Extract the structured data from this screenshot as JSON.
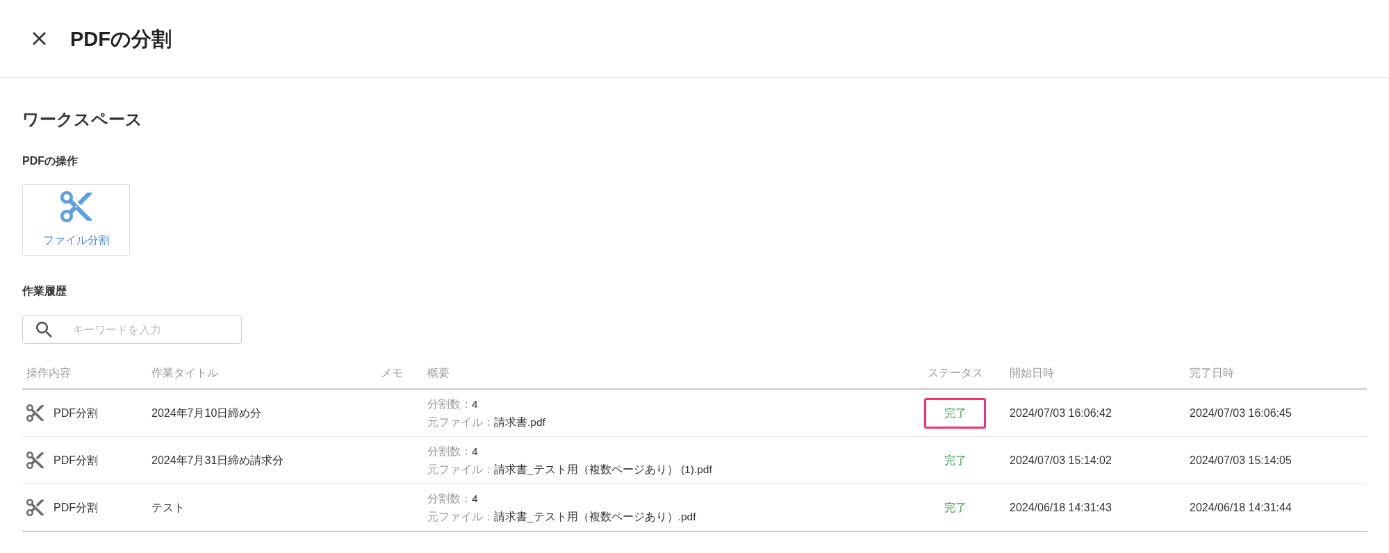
{
  "header": {
    "title": "PDFの分割"
  },
  "workspace": {
    "title": "ワークスペース"
  },
  "operations": {
    "heading": "PDFの操作",
    "items": [
      {
        "label": "ファイル分割"
      }
    ]
  },
  "history": {
    "heading": "作業履歴",
    "search": {
      "placeholder": "キーワードを入力"
    },
    "columns": [
      "操作内容",
      "作業タイトル",
      "メモ",
      "概要",
      "ステータス",
      "開始日時",
      "完了日時"
    ],
    "rows": [
      {
        "operation": "PDF分割",
        "title": "2024年7月10日締め分",
        "summary": [
          {
            "label": "分割数：",
            "value": "4"
          },
          {
            "label": "元ファイル：",
            "value": "請求書.pdf"
          }
        ],
        "status": "完了",
        "highlighted": true,
        "started": "2024/07/03 16:06:42",
        "finished": "2024/07/03 16:06:45"
      },
      {
        "operation": "PDF分割",
        "title": "2024年7月31日締め請求分",
        "summary": [
          {
            "label": "分割数：",
            "value": "4"
          },
          {
            "label": "元ファイル：",
            "value": "請求書_テスト用（複数ページあり） (1).pdf"
          }
        ],
        "status": "完了",
        "highlighted": false,
        "started": "2024/07/03 15:14:02",
        "finished": "2024/07/03 15:14:05"
      },
      {
        "operation": "PDF分割",
        "title": "テスト",
        "summary": [
          {
            "label": "分割数：",
            "value": "4"
          },
          {
            "label": "元ファイル：",
            "value": "請求書_テスト用（複数ページあり）.pdf"
          }
        ],
        "status": "完了",
        "highlighted": false,
        "started": "2024/06/18 14:31:43",
        "finished": "2024/06/18 14:31:44"
      }
    ]
  }
}
